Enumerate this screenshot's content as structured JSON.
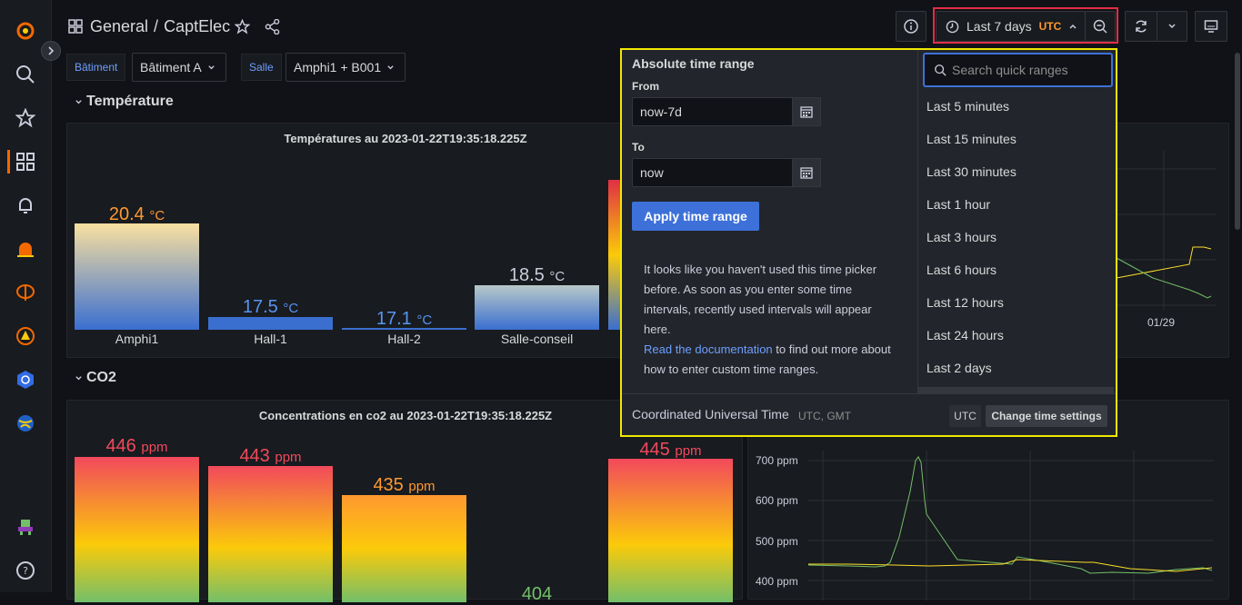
{
  "breadcrumb": {
    "folder": "General",
    "separator": "/",
    "dashboard": "CaptElec"
  },
  "toolbar": {
    "time_range_label": "Last 7 days",
    "timezone_badge": "UTC"
  },
  "variables": [
    {
      "label": "Bâtiment",
      "value": "Bâtiment A"
    },
    {
      "label": "Salle",
      "value": "Amphi1 + B001"
    }
  ],
  "rows": {
    "temperature": "Température",
    "co2": "CO2"
  },
  "temp_panel": {
    "title": "Températures au 2023-01-22T19:35:18.225Z",
    "bars": [
      {
        "label": "Amphi1",
        "value": "20.4",
        "unit": "°C",
        "color": "#ff9830"
      },
      {
        "label": "Hall-1",
        "value": "17.5",
        "unit": "°C",
        "color": "#5794f2"
      },
      {
        "label": "Hall-2",
        "value": "17.1",
        "unit": "°C",
        "color": "#5794f2"
      },
      {
        "label": "Salle-conseil",
        "value": "18.5",
        "unit": "°C",
        "color": "#ccccdc"
      }
    ]
  },
  "co2_panel": {
    "title": "Concentrations en co2 au 2023-01-22T19:35:18.225Z",
    "bars": [
      {
        "value": "446",
        "unit": "ppm",
        "color": "#f2495c"
      },
      {
        "value": "443",
        "unit": "ppm",
        "color": "#f2495c"
      },
      {
        "value": "435",
        "unit": "ppm",
        "color": "#ff9830"
      },
      {
        "value": "404",
        "unit": "",
        "color": "#73bf69"
      },
      {
        "value": "445",
        "unit": "ppm",
        "color": "#f2495c"
      }
    ]
  },
  "co2_timeseries": {
    "y_ticks": [
      "700 ppm",
      "600 ppm",
      "500 ppm",
      "400 ppm"
    ]
  },
  "temp_timeseries": {
    "x_tick": "01/29"
  },
  "picker": {
    "heading": "Absolute time range",
    "from_label": "From",
    "from_value": "now-7d",
    "to_label": "To",
    "to_value": "now",
    "apply_label": "Apply time range",
    "help_text": "It looks like you haven't used this time picker before. As soon as you enter some time intervals, recently used intervals will appear here.",
    "doc_link": "Read the documentation",
    "help_tail": "to find out more about how to enter custom time ranges.",
    "search_placeholder": "Search quick ranges",
    "quick_ranges": [
      "Last 5 minutes",
      "Last 15 minutes",
      "Last 30 minutes",
      "Last 1 hour",
      "Last 3 hours",
      "Last 6 hours",
      "Last 12 hours",
      "Last 24 hours",
      "Last 2 days"
    ],
    "tz_name": "Coordinated Universal Time",
    "tz_abbr": "UTC, GMT",
    "tz_badge": "UTC",
    "change_tz_label": "Change time settings"
  },
  "colors": {
    "accent": "#3d71d9",
    "highlight_red": "#e02f44",
    "highlight_yellow": "#f2e800"
  }
}
